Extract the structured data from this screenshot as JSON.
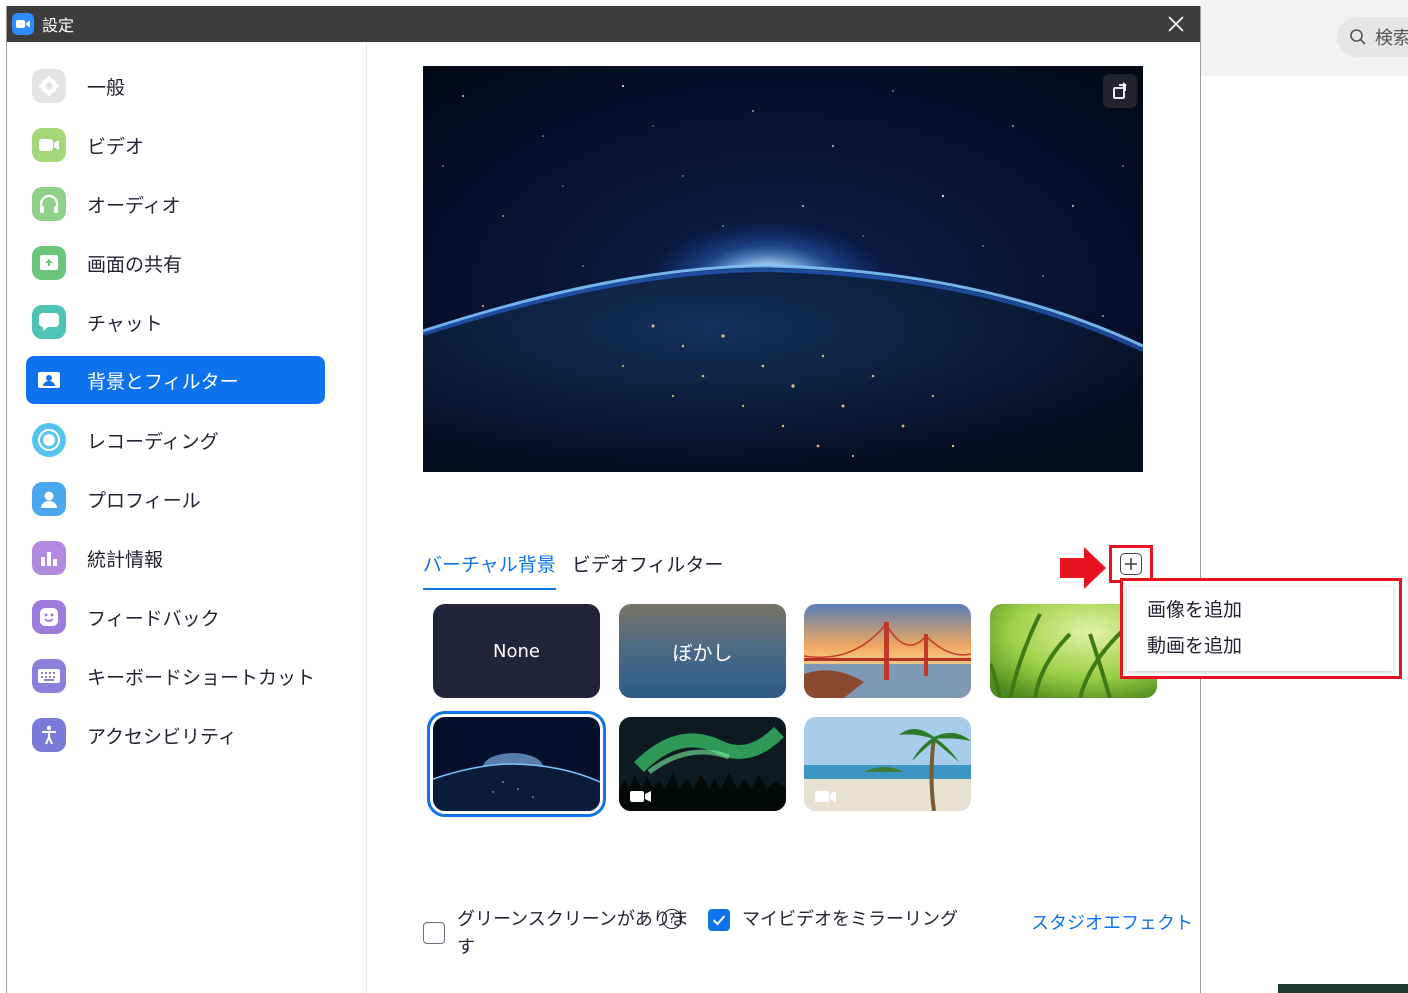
{
  "window": {
    "title": "設定",
    "close_icon": "close-icon"
  },
  "background_app": {
    "search_placeholder": "検索"
  },
  "sidebar": {
    "items": [
      {
        "label": "一般",
        "icon": "gear-icon",
        "color": "#e4e4e6"
      },
      {
        "label": "ビデオ",
        "icon": "video-camera-icon",
        "color": "#a4d67a"
      },
      {
        "label": "オーディオ",
        "icon": "headphones-icon",
        "color": "#8fd08a"
      },
      {
        "label": "画面の共有",
        "icon": "share-screen-icon",
        "color": "#6bc57a"
      },
      {
        "label": "チャット",
        "icon": "chat-bubble-icon",
        "color": "#4fc3b5"
      },
      {
        "label": "背景とフィルター",
        "icon": "person-card-icon",
        "color": "#0e72ed",
        "active": true
      },
      {
        "label": "レコーディング",
        "icon": "record-icon",
        "color": "#55c5f0"
      },
      {
        "label": "プロフィール",
        "icon": "profile-icon",
        "color": "#4aa8f0"
      },
      {
        "label": "統計情報",
        "icon": "statistics-icon",
        "color": "#b18ae0"
      },
      {
        "label": "フィードバック",
        "icon": "smiley-icon",
        "color": "#9d7bdc"
      },
      {
        "label": "キーボードショートカット",
        "icon": "keyboard-icon",
        "color": "#8b7fdc"
      },
      {
        "label": "アクセシビリティ",
        "icon": "accessibility-icon",
        "color": "#7a7ad8"
      }
    ]
  },
  "main": {
    "tabs": [
      {
        "label": "バーチャル背景",
        "active": true
      },
      {
        "label": "ビデオフィルター",
        "active": false
      }
    ],
    "add_button_icon": "plus-icon",
    "backgrounds": [
      {
        "label": "None",
        "kind": "none"
      },
      {
        "label": "ぼかし",
        "kind": "blur"
      },
      {
        "label": "",
        "kind": "golden-gate"
      },
      {
        "label": "",
        "kind": "grass"
      },
      {
        "label": "",
        "kind": "earth",
        "selected": true
      },
      {
        "label": "",
        "kind": "aurora",
        "video": true
      },
      {
        "label": "",
        "kind": "beach",
        "video": true
      }
    ],
    "add_menu": {
      "items": [
        "画像を追加",
        "動画を追加"
      ]
    },
    "options": {
      "green_screen_line1": "グリーンスクリーンがありま",
      "green_screen_line2": "す",
      "green_screen_checked": false,
      "mirror_label": "マイビデオをミラーリング",
      "mirror_checked": true,
      "studio_effects_link": "スタジオエフェクト"
    }
  }
}
